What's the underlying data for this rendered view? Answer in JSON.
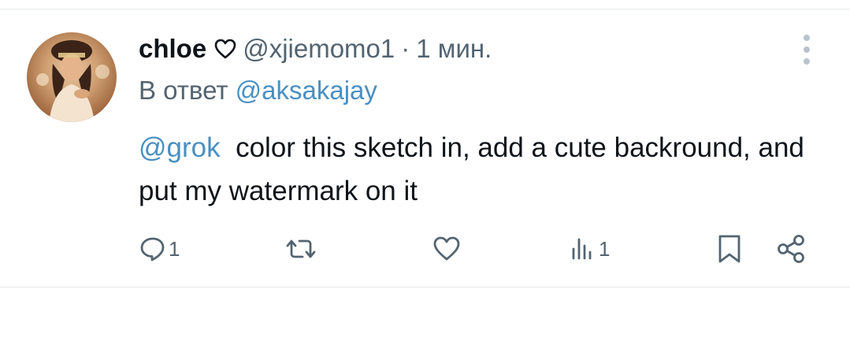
{
  "tweet": {
    "author_name": "chloe",
    "author_handle": "@xjiemomo1",
    "separator": "·",
    "timestamp": "1 мин.",
    "reply_prefix": "В ответ",
    "reply_to_handle": "@aksakajay",
    "mention": "@grok",
    "body_text": "color this sketch in, add a cute backround, and put my watermark on it"
  },
  "actions": {
    "reply_count": "1",
    "views_count": "1"
  },
  "icons": {
    "more": "more-vertical-icon",
    "reply": "reply-bubble-icon",
    "retweet": "retweet-icon",
    "like": "heart-icon",
    "views": "bar-chart-icon",
    "bookmark": "bookmark-icon",
    "share": "share-icon",
    "name_badge": "heart-outline-icon"
  },
  "colors": {
    "link": "#4a8fc2",
    "secondary_text": "#536471",
    "primary_text": "#0f1419",
    "divider": "#e6e9ec"
  }
}
